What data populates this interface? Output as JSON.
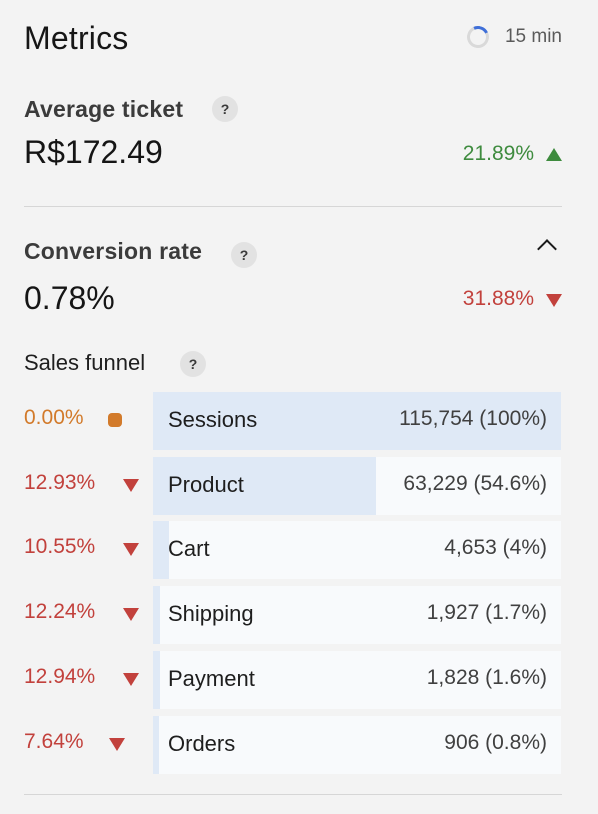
{
  "header": {
    "title": "Metrics",
    "refresh_interval": "15 min",
    "spinner_color": "#3f6fd8"
  },
  "average_ticket": {
    "label": "Average ticket",
    "help": "?",
    "value": "R$172.49",
    "change": "21.89%",
    "trend": "up"
  },
  "conversion_rate": {
    "label": "Conversion rate",
    "help": "?",
    "value": "0.78%",
    "change": "31.88%",
    "trend": "down",
    "expanded": true
  },
  "sales_funnel": {
    "title": "Sales funnel",
    "help": "?",
    "stages": [
      {
        "change": "0.00%",
        "trend": "neutral",
        "name": "Sessions",
        "count": "115,754 (100%)",
        "share": 100
      },
      {
        "change": "12.93%",
        "trend": "down",
        "name": "Product",
        "count": "63,229 (54.6%)",
        "share": 54.6
      },
      {
        "change": "10.55%",
        "trend": "down",
        "name": "Cart",
        "count": "4,653 (4%)",
        "share": 4
      },
      {
        "change": "12.24%",
        "trend": "down",
        "name": "Shipping",
        "count": "1,927 (1.7%)",
        "share": 1.7
      },
      {
        "change": "12.94%",
        "trend": "down",
        "name": "Payment",
        "count": "1,828 (1.6%)",
        "share": 1.6
      },
      {
        "change": "7.64%",
        "trend": "down",
        "name": "Orders",
        "count": "906 (0.8%)",
        "share": 0.8
      }
    ]
  },
  "colors": {
    "positive": "#3e8b3e",
    "negative": "#c2413c",
    "neutral": "#d27a2a",
    "bar_fill": "#dfe9f6"
  }
}
